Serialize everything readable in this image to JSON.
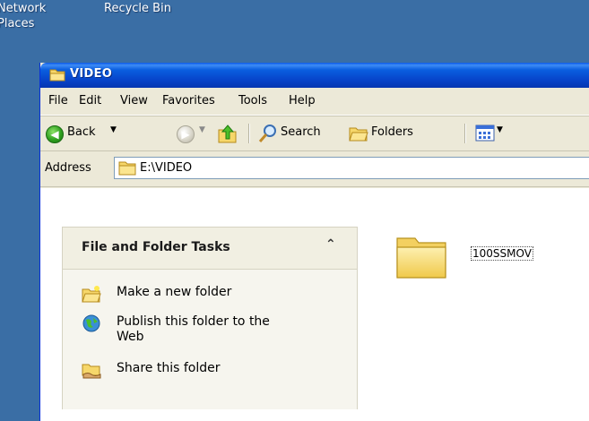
{
  "desktop": {
    "items": [
      {
        "label_line1": "Network",
        "label_line2": "Places"
      },
      {
        "label_line1": "Recycle Bin"
      }
    ]
  },
  "window": {
    "title": "VIDEO",
    "title_icon": "folder-icon"
  },
  "menubar": {
    "items": [
      "File",
      "Edit",
      "View",
      "Favorites",
      "Tools",
      "Help"
    ]
  },
  "toolbar": {
    "back_label": "Back",
    "search_label": "Search",
    "folders_label": "Folders",
    "icons": [
      "back-arrow-icon",
      "forward-arrow-icon",
      "up-folder-icon",
      "search-icon",
      "folders-icon",
      "views-icon"
    ]
  },
  "address": {
    "label": "Address",
    "value": "E:\\VIDEO"
  },
  "taskpane": {
    "title": "File and Folder Tasks",
    "collapse_glyph": "»",
    "tasks": [
      {
        "label": "Make a new folder",
        "icon": "new-folder-icon"
      },
      {
        "label_line1": "Publish this folder to the",
        "label_line2": "Web",
        "icon": "globe-icon"
      },
      {
        "label": "Share this folder",
        "icon": "share-folder-icon"
      }
    ]
  },
  "files": [
    {
      "name": "100SSMOV",
      "icon": "folder-icon"
    }
  ],
  "colors": {
    "desktop": "#3a6ea5",
    "titlebar": "#0743c9",
    "chrome": "#ece9d8",
    "taskpane": "#f1efe2"
  }
}
